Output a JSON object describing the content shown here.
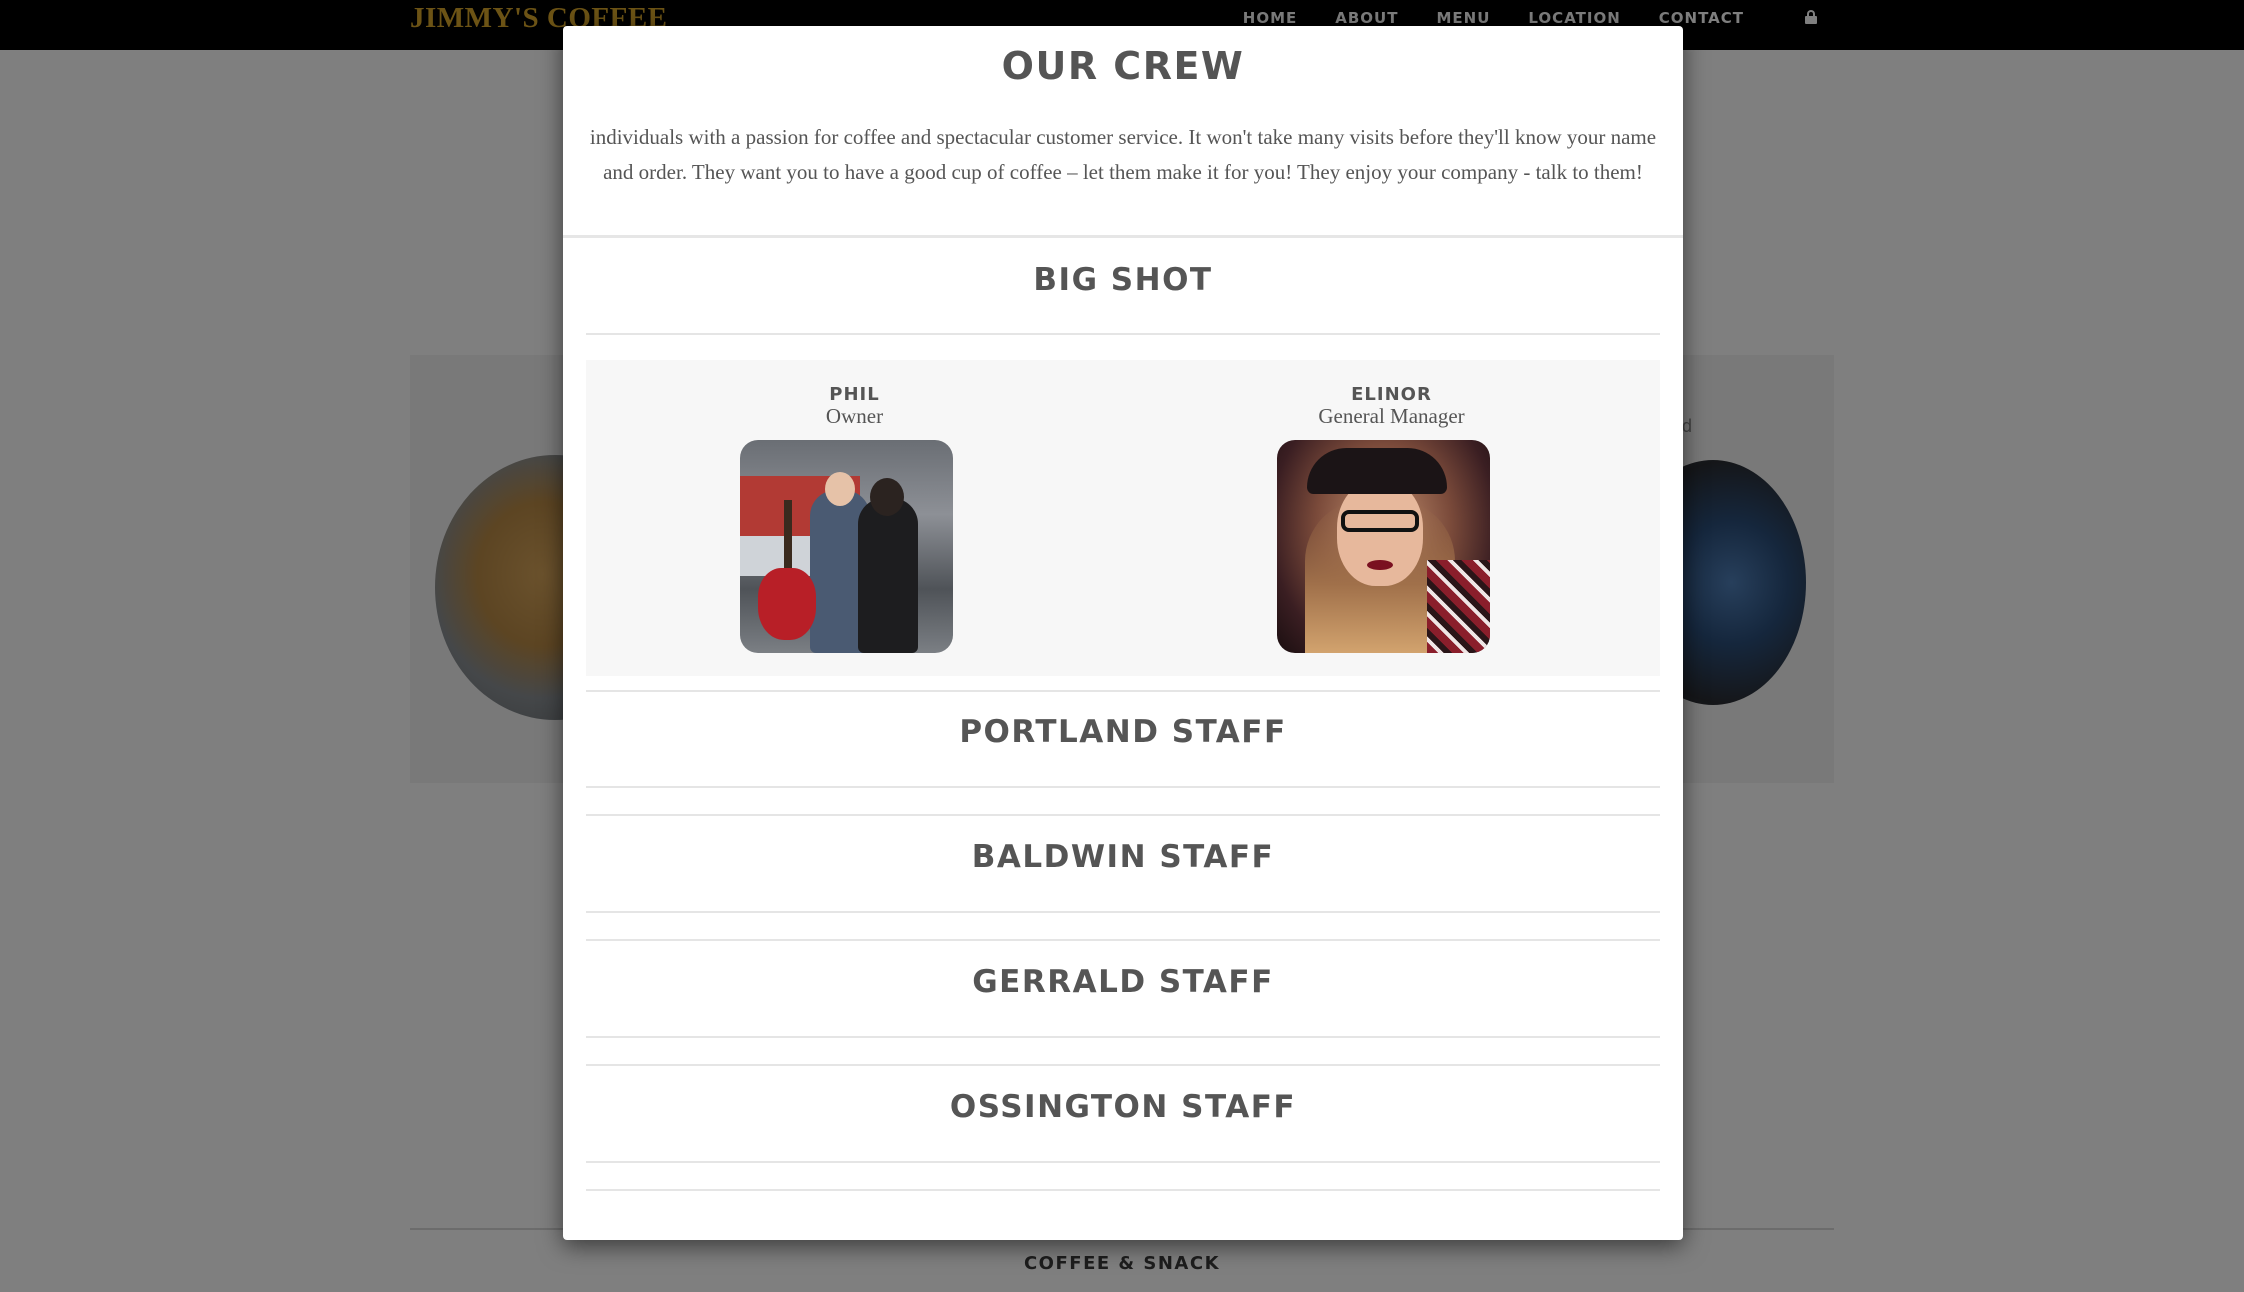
{
  "site": {
    "brand": "JIMMY'S COFFEE",
    "nav": [
      {
        "label": "HOME"
      },
      {
        "label": "ABOUT"
      },
      {
        "label": "MENU"
      },
      {
        "label": "LOCATION"
      },
      {
        "label": "CONTACT"
      }
    ],
    "lock_icon": "lock-icon",
    "background_fragment": "ald",
    "footer_label": "COFFEE & SNACK"
  },
  "modal": {
    "title": "OUR CREW",
    "intro": "individuals with a passion for coffee and spectacular customer service. It won't take many visits before they'll know your name and order. They want you to have a good cup of coffee – let them make it for you! They enjoy your company - talk to them!",
    "sections": [
      {
        "title": "BIG SHOT"
      },
      {
        "title": "PORTLAND STAFF"
      },
      {
        "title": "BALDWIN STAFF"
      },
      {
        "title": "GERRALD STAFF"
      },
      {
        "title": "OSSINGTON STAFF"
      }
    ],
    "members": [
      {
        "name": "PHIL",
        "role": "Owner"
      },
      {
        "name": "ELINOR",
        "role": "General Manager"
      }
    ]
  },
  "colors": {
    "brand": "#d9a72a",
    "topbar": "#000000",
    "heading": "#555555",
    "overlay": "rgba(0,0,0,0.5)"
  }
}
